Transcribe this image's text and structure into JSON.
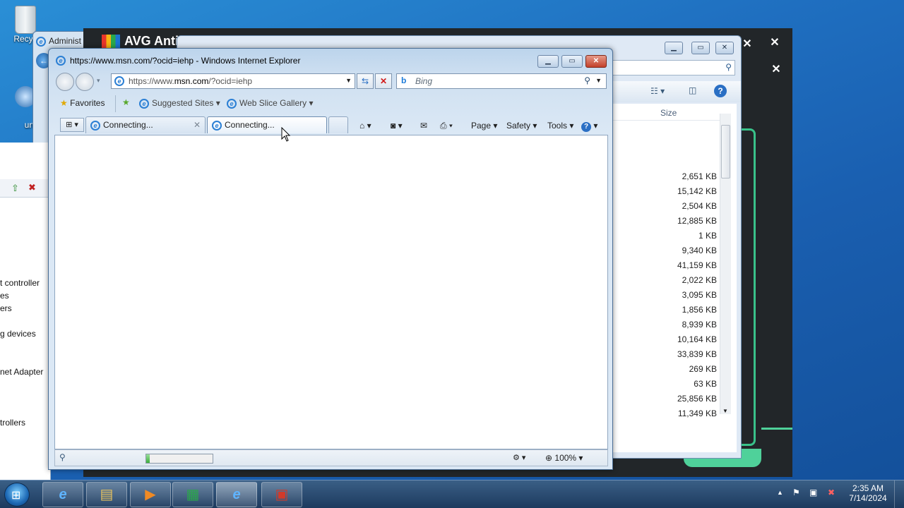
{
  "desktop": {
    "recycle_label": "Recyc",
    "second_icon_label": "un"
  },
  "admin_window": {
    "title": "Administ"
  },
  "device_manager": {
    "items": [
      "t controller",
      "es",
      "ers",
      "g devices",
      "net Adapter",
      "trollers"
    ]
  },
  "avg": {
    "title": "AVG Anti"
  },
  "explorer": {
    "size_header": "Size",
    "sizes": [
      "2,651 KB",
      "15,142 KB",
      "2,504 KB",
      "12,885 KB",
      "1 KB",
      "9,340 KB",
      "41,159 KB",
      "2,022 KB",
      "3,095 KB",
      "1,856 KB",
      "8,939 KB",
      "10,164 KB",
      "33,839 KB",
      "269 KB",
      "63 KB",
      "25,856 KB",
      "11,349 KB"
    ]
  },
  "ie": {
    "title": "https://www.msn.com/?ocid=iehp - Windows Internet Explorer",
    "address_prefix": "https://www.",
    "address_domain": "msn.com",
    "address_suffix": "/?ocid=iehp",
    "search_placeholder": "Bing",
    "favorites_label": "Favorites",
    "suggested_sites_label": "Suggested Sites",
    "web_slice_label": "Web Slice Gallery",
    "tabs": [
      {
        "label": "Connecting..."
      },
      {
        "label": "Connecting..."
      }
    ],
    "commands": {
      "page": "Page",
      "safety": "Safety",
      "tools": "Tools"
    },
    "zoom": "100%",
    "progress": 0.05
  },
  "taskbar": {
    "time": "2:35 AM",
    "date": "7/14/2024"
  }
}
